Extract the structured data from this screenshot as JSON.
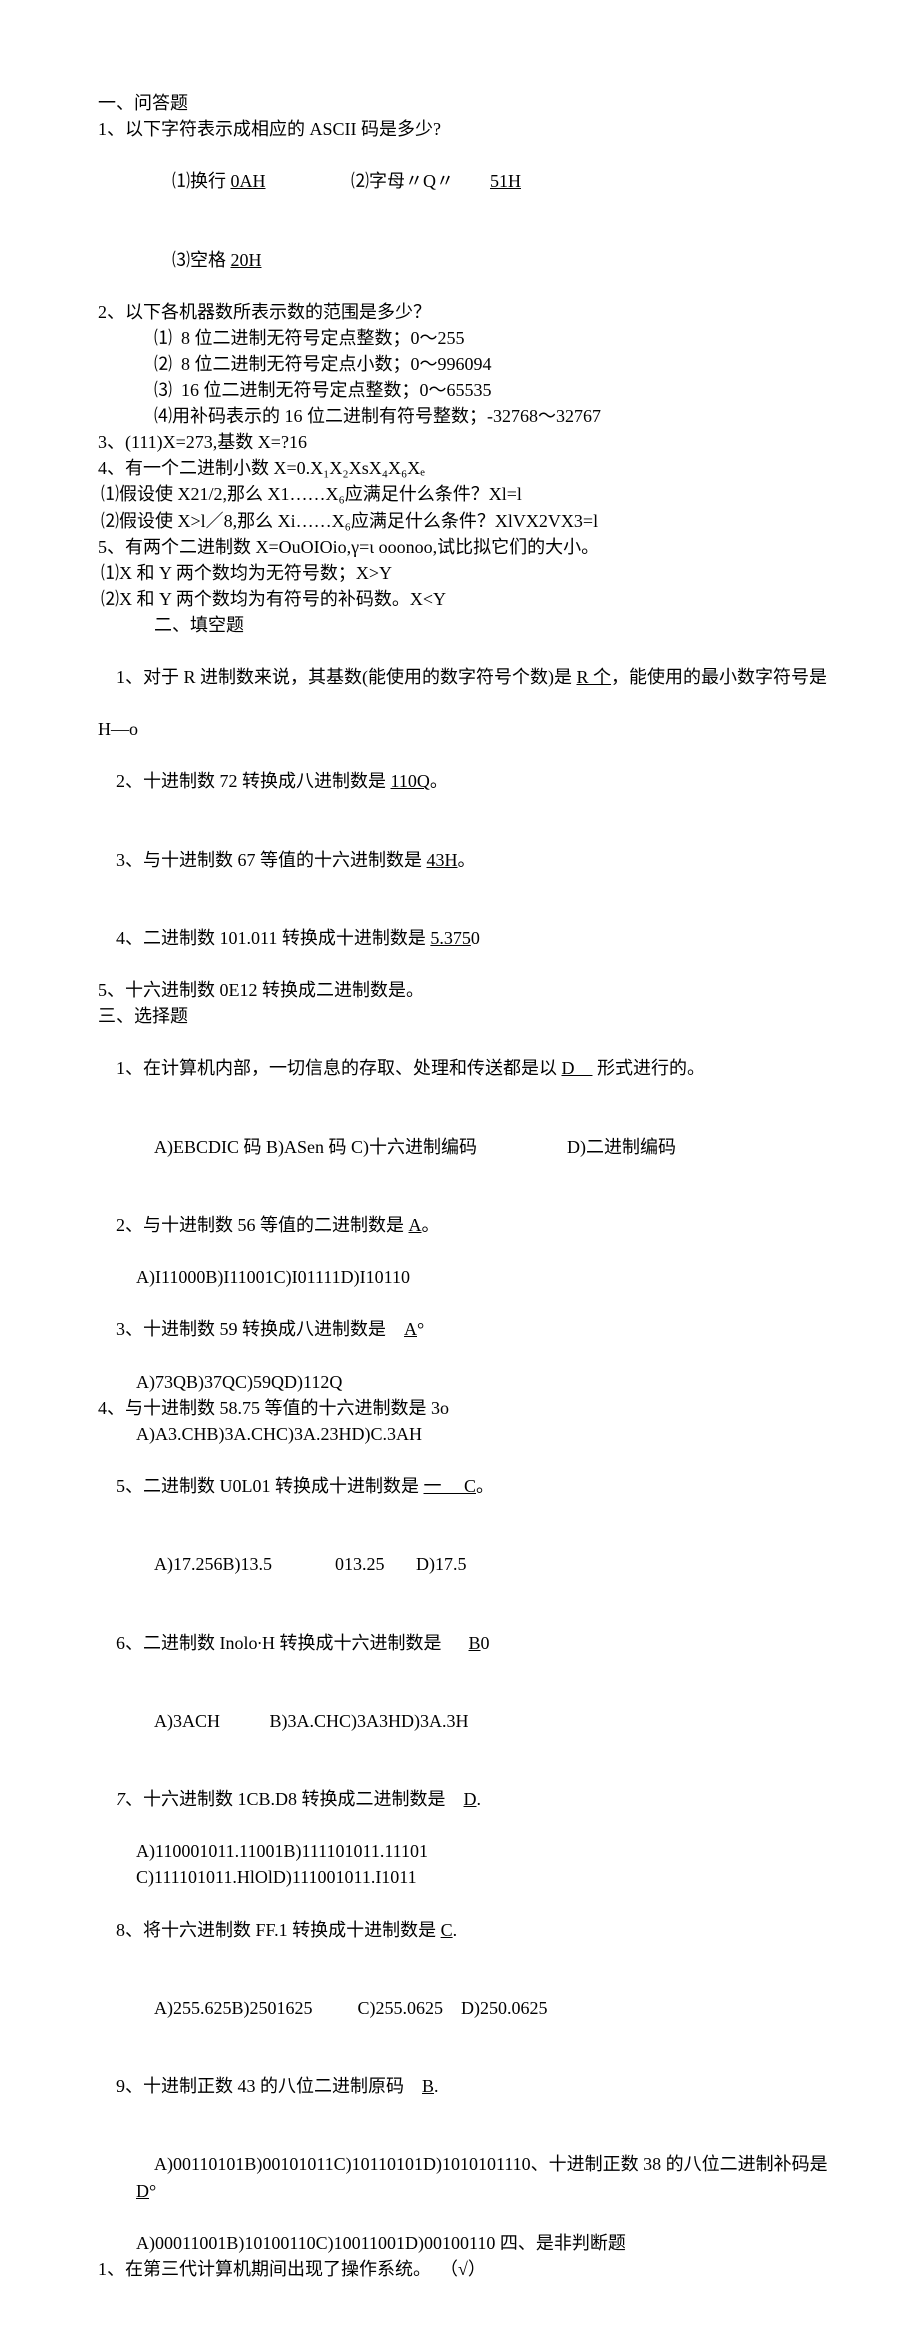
{
  "s1_title": "一、问答题",
  "q1": "1、以下字符表示成相应的 ASCII 码是多少?",
  "q1_1a": "⑴换行 ",
  "q1_1b": "0AH",
  "q1_2a": "⑵字母〃Q〃",
  "q1_2b": "51H",
  "q1_3a": "⑶空格 ",
  "q1_3b": "20H",
  "q2": "2、以下各机器数所表示数的范围是多少？",
  "q2_1": "⑴  8 位二进制无符号定点整数；0～255",
  "q2_2": "⑵  8 位二进制无符号定点小数；0～996094",
  "q2_3": "⑶  16 位二进制无符号定点整数；0～65535",
  "q2_4": "⑷用补码表示的 16 位二进制有符号整数；-32768～32767",
  "q3": "3、(111)X=273,基数 X=?16",
  "q4": "4、有一个二进制小数 X=0.X₁X₂XsX₄X₆Xₑ",
  "q4_1": "⑴假设使 X21/2,那么 X1……X₆应满足什么条件？Xl=l",
  "q4_2": "⑵假设使 X>l／8,那么 Xi……X₆应满足什么条件？XlVX2VX3=l",
  "q5": "5、有两个二进制数 X=OuOIOio,γ=ι ooonoo,试比拟它们的大小。",
  "q5_1": "⑴X 和 Y 两个数均为无符号数；X>Y",
  "q5_2": "⑵X 和 Y 两个数均为有符号的补码数。X<Y",
  "s2_title": "二、填空题",
  "b1a": "1、对于 R 进制数来说，其基数(能使用的数字符号个数)是 ",
  "b1b": "R 个",
  "b1c": "，能使用的最小数字符号是",
  "b1d": "H—o",
  "b2a": "2、十进制数 72 转换成八进制数是 ",
  "b2b": "110Q",
  "b2c": "。",
  "b3a": "3、与十进制数 67 等值的十六进制数是 ",
  "b3b": "43H",
  "b3c": "。",
  "b4a": "4、二进制数 101.011 转换成十进制数是 ",
  "b4b": "5.375",
  "b4c": "0",
  "b5": "5、十六进制数 0E12 转换成二进制数是。",
  "s3_title": "三、选择题",
  "c1a": "1、在计算机内部，一切信息的存取、处理和传送都是以 ",
  "c1b": "D    ",
  "c1c": " 形式进行的。",
  "c1opts_a": "A)EBCDIC 码 B)ASen 码 C)十六进制编码",
  "c1opts_d": "D)二进制编码",
  "c2a": "2、与十进制数 56 等值的二进制数是 ",
  "c2b": "A",
  "c2c": "。",
  "c2opts": "A)I11000B)I11001C)I01111D)I10110",
  "c3a": "3、十进制数 59 转换成八进制数是",
  "c3b": "A",
  "c3c": "°",
  "c3opts": "A)73QB)37QC)59QD)112Q",
  "c4": "4、与十进制数 58.75 等值的十六进制数是 3o",
  "c4opts": "A)A3.CHB)3A.CHC)3A.23HD)C.3AH",
  "c5a": "5、二进制数 U0L01 转换成十进制数是 ",
  "c5b": "一     C",
  "c5c": "。",
  "c5opts_a": "A)17.256B)13.5",
  "c5opts_c": "013.25",
  "c5opts_d": "D)17.5",
  "c6a": "6、二进制数 Inolo∙H 转换成十六进制数是",
  "c6b": "B",
  "c6c": "0",
  "c6opts_a": "A)3ACH",
  "c6opts_b": "B)3A.CHC)3A3HD)3A.3H",
  "c7a": "7、十六进制数 1CB.D8 转换成二进制数是",
  "c7b": "D",
  "c7c": ".",
  "c7opts1": "A)110001011.11001B)111101011.11101",
  "c7opts2": "C)111101011.HlOlD)111001011.I1011",
  "c8a": "8、将十六进制数 FF.1 转换成十进制数是 ",
  "c8b": "C",
  "c8c": ".",
  "c8opts_a": "A)255.625B)2501625",
  "c8opts_c": "C)255.0625",
  "c8opts_d": "D)250.0625",
  "c9a": "9、十进制正数 43 的八位二进制原码",
  "c9b": "B",
  "c9c": ".",
  "c9opts_a": "A)00110101B)00101011C)10110101D)1010101110、十进制正数 38 的八位二进制补码是 ",
  "c9opts_b": "D",
  "c9opts_c": "°",
  "c10opts": "A)00011001B)10100110C)10011001D)00100110 四、是非判断题",
  "tf1": "1、在第三代计算机期间出现了操作系统。  （√）"
}
